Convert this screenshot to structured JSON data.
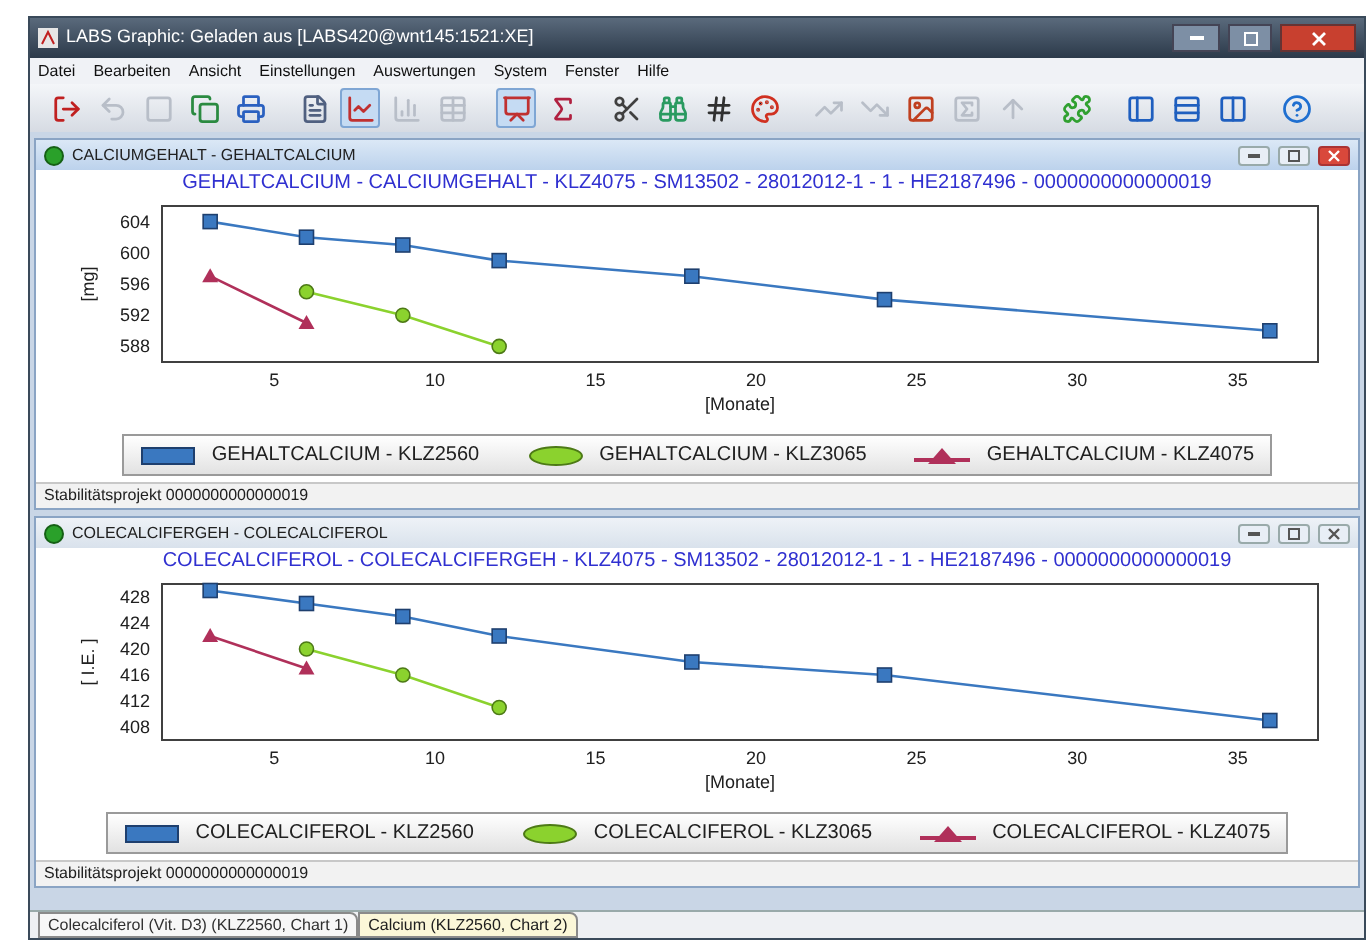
{
  "window": {
    "title": "LABS Graphic: Geladen aus [LABS420@wnt145:1521:XE]"
  },
  "menu": [
    {
      "label": "Datei"
    },
    {
      "label": "Bearbeiten"
    },
    {
      "label": "Ansicht"
    },
    {
      "label": "Einstellungen"
    },
    {
      "label": "Auswertungen"
    },
    {
      "label": "System"
    },
    {
      "label": "Fenster"
    },
    {
      "label": "Hilfe"
    }
  ],
  "toolbar": [
    {
      "disabled": false,
      "pressed": false
    },
    {
      "disabled": true,
      "pressed": false
    },
    {
      "disabled": true,
      "pressed": false
    },
    {
      "disabled": false,
      "pressed": false
    },
    {
      "disabled": false,
      "pressed": false
    },
    {
      "disabled": false,
      "pressed": false
    },
    {
      "disabled": false,
      "pressed": true
    },
    {
      "disabled": true,
      "pressed": false
    },
    {
      "disabled": true,
      "pressed": false
    },
    {
      "disabled": false,
      "pressed": true
    },
    {
      "disabled": false,
      "pressed": false
    },
    {
      "disabled": false,
      "pressed": false
    },
    {
      "disabled": false,
      "pressed": false
    },
    {
      "disabled": false,
      "pressed": false
    },
    {
      "disabled": false,
      "pressed": false
    },
    {
      "disabled": true,
      "pressed": false
    },
    {
      "disabled": true,
      "pressed": false
    },
    {
      "disabled": false,
      "pressed": false
    },
    {
      "disabled": true,
      "pressed": false
    },
    {
      "disabled": true,
      "pressed": false
    },
    {
      "disabled": false,
      "pressed": false
    },
    {
      "disabled": false,
      "pressed": false
    },
    {
      "disabled": false,
      "pressed": false
    },
    {
      "disabled": false,
      "pressed": false
    },
    {
      "disabled": false,
      "pressed": false
    }
  ],
  "panels": [
    {
      "title": "CALCIUMGEHALT - GEHALTCALCIUM",
      "active": true,
      "status": "Stabilitätsprojekt 0000000000000019",
      "chart_data": {
        "type": "line",
        "title": "GEHALTCALCIUM  -  CALCIUMGEHALT  -  KLZ4075  -  SM13502  -  28012012-1  -  1  -  HE2187496  -  0000000000000019",
        "xlabel": "[Monate]",
        "ylabel": "[mg]",
        "x": [
          3,
          6,
          9,
          12,
          18,
          24,
          36
        ],
        "xlim": [
          1.5,
          37.5
        ],
        "ylim": [
          586,
          606
        ],
        "xticks": [
          5,
          10,
          15,
          20,
          25,
          30,
          35
        ],
        "yticks": [
          588,
          592,
          596,
          600,
          604
        ],
        "series": [
          {
            "name": "GEHALTCALCIUM - KLZ2560",
            "color": "#3a78c0",
            "marker": "square",
            "values": [
              604,
              602,
              601,
              599,
              597,
              594,
              590
            ]
          },
          {
            "name": "GEHALTCALCIUM - KLZ3065",
            "color": "#8bd22e",
            "marker": "circle",
            "values": [
              null,
              595,
              592,
              588,
              null,
              null,
              null
            ]
          },
          {
            "name": "GEHALTCALCIUM - KLZ4075",
            "color": "#b0305a",
            "marker": "triangle",
            "values": [
              597,
              591,
              null,
              null,
              null,
              null,
              null
            ]
          }
        ]
      }
    },
    {
      "title": "COLECALCIFERGEH - COLECALCIFEROL",
      "active": false,
      "status": "Stabilitätsprojekt 0000000000000019",
      "chart_data": {
        "type": "line",
        "title": "COLECALCIFEROL  -  COLECALCIFERGEH  -  KLZ4075  -  SM13502  -  28012012-1  -  1  -  HE2187496  -  0000000000000019",
        "xlabel": "[Monate]",
        "ylabel": "[ I.E. ]",
        "x": [
          3,
          6,
          9,
          12,
          18,
          24,
          36
        ],
        "xlim": [
          1.5,
          37.5
        ],
        "ylim": [
          406,
          430
        ],
        "xticks": [
          5,
          10,
          15,
          20,
          25,
          30,
          35
        ],
        "yticks": [
          408,
          412,
          416,
          420,
          424,
          428
        ],
        "series": [
          {
            "name": "COLECALCIFEROL - KLZ2560",
            "color": "#3a78c0",
            "marker": "square",
            "values": [
              429,
              427,
              425,
              422,
              418,
              416,
              409
            ]
          },
          {
            "name": "COLECALCIFEROL - KLZ3065",
            "color": "#8bd22e",
            "marker": "circle",
            "values": [
              null,
              420,
              416,
              411,
              null,
              null,
              null
            ]
          },
          {
            "name": "COLECALCIFEROL - KLZ4075",
            "color": "#b0305a",
            "marker": "triangle",
            "values": [
              422,
              417,
              null,
              null,
              null,
              null,
              null
            ]
          }
        ]
      }
    }
  ],
  "tabs": [
    {
      "label": "Colecalciferol (Vit. D3) (KLZ2560, Chart 1)",
      "selected": false
    },
    {
      "label": "Calcium (KLZ2560, Chart 2)",
      "selected": true
    }
  ]
}
